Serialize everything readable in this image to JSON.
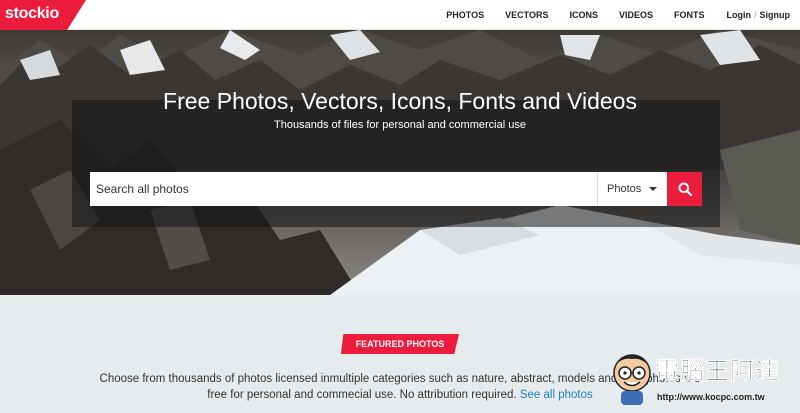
{
  "brand": {
    "logo_text": "stockio",
    "accent": "#ec1c3c"
  },
  "nav": {
    "items": [
      {
        "label": "PHOTOS"
      },
      {
        "label": "VECTORS"
      },
      {
        "label": "ICONS"
      },
      {
        "label": "VIDEOS"
      },
      {
        "label": "FONTS"
      }
    ],
    "login_label": "Login",
    "separator": "/",
    "signup_label": "Signup"
  },
  "hero": {
    "title": "Free Photos, Vectors, Icons, Fonts and Videos",
    "subtitle": "Thousands of files for personal and commercial use",
    "search": {
      "placeholder": "Search all photos",
      "value": "",
      "type_selected": "Photos",
      "button_icon": "search-icon"
    }
  },
  "featured": {
    "badge": "FEATURED PHOTOS",
    "description_line1": "Choose from thousands of photos licensed inmultiple categories such as nature, abstract, models and man",
    "description_line1_tail": "photos are",
    "description_line2": "free for personal and commecial use. No attribution required.",
    "see_all_label": "See all photos",
    "link_color": "#1a7fc1"
  },
  "watermark": {
    "name": "電腦王阿達",
    "url": "http://www.kocpc.com.tw"
  }
}
